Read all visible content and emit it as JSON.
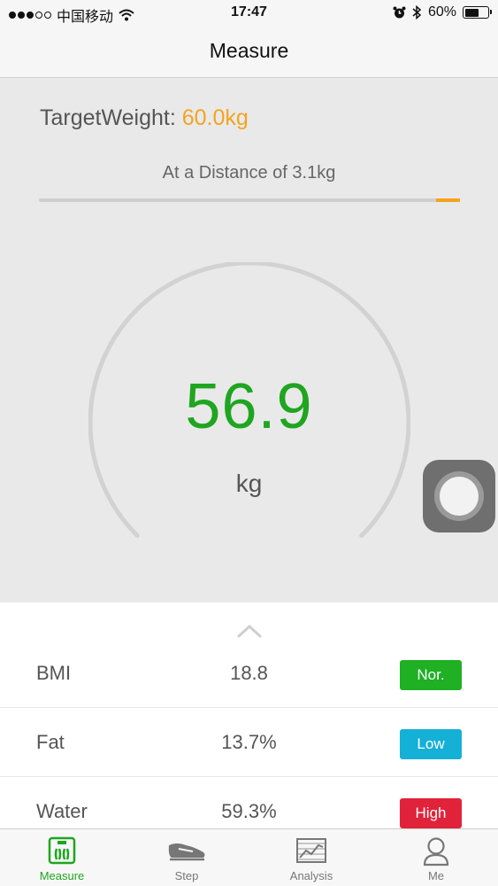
{
  "status_bar": {
    "carrier": "中国移动",
    "time": "17:47",
    "battery_text": "60%",
    "battery_level": 0.6
  },
  "nav": {
    "title": "Measure"
  },
  "target": {
    "label": "TargetWeight:",
    "value": "60.0kg",
    "distance_text": "At a Distance of 3.1kg",
    "progress_marker_position": 0.95
  },
  "gauge": {
    "value": "56.9",
    "unit": "kg"
  },
  "metrics": [
    {
      "name": "BMI",
      "value": "18.8",
      "badge": "Nor.",
      "badge_color": "#1fb024"
    },
    {
      "name": "Fat",
      "value": "13.7%",
      "badge": "Low",
      "badge_color": "#15b0d6"
    },
    {
      "name": "Water",
      "value": "59.3%",
      "badge": "High",
      "badge_color": "#e0233a"
    }
  ],
  "tabs": [
    {
      "label": "Measure",
      "icon": "measure-scale-icon",
      "active": true
    },
    {
      "label": "Step",
      "icon": "shoe-icon",
      "active": false
    },
    {
      "label": "Analysis",
      "icon": "chart-icon",
      "active": false
    },
    {
      "label": "Me",
      "icon": "person-icon",
      "active": false
    }
  ],
  "colors": {
    "accent_green": "#1fa51f",
    "target_orange": "#f3a41f"
  }
}
